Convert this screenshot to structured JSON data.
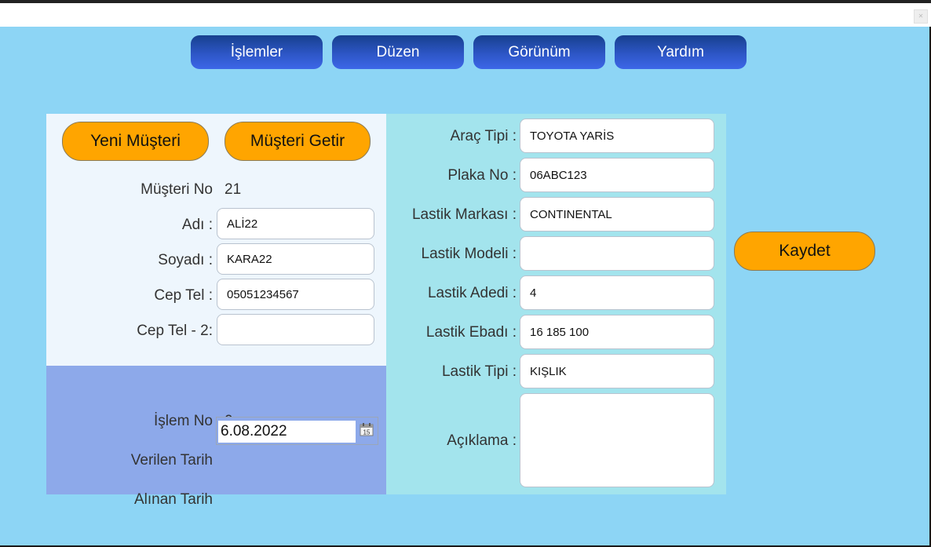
{
  "menu": {
    "items": [
      "İşlemler",
      "Düzen",
      "Görünüm",
      "Yardım"
    ]
  },
  "customer": {
    "new_button": "Yeni Müşteri",
    "fetch_button": "Müşteri Getir",
    "no_label": "Müşteri No",
    "no_value": "21",
    "name_label": "Adı :",
    "name_value": "ALİ22",
    "surname_label": "Soyadı :",
    "surname_value": "KARA22",
    "phone_label": "Cep Tel :",
    "phone_value": "05051234567",
    "phone2_label": "Cep Tel - 2:",
    "phone2_value": ""
  },
  "transaction": {
    "no_label": "İşlem No",
    "no_value": "0",
    "given_date_label": "Verilen Tarih",
    "given_date_value": "6.08.2022",
    "calendar_day": "15",
    "received_date_label": "Alınan Tarih"
  },
  "vehicle": {
    "type_label": "Araç Tipi :",
    "type_value": "TOYOTA YARİS",
    "plate_label": "Plaka No :",
    "plate_value": "06ABC123",
    "tire_brand_label": "Lastik Markası :",
    "tire_brand_value": "CONTINENTAL",
    "tire_model_label": "Lastik Modeli :",
    "tire_model_value": "",
    "tire_count_label": "Lastik Adedi :",
    "tire_count_value": "4",
    "tire_size_label": "Lastik Ebadı :",
    "tire_size_value": "16 185 100",
    "tire_type_label": "Lastik Tipi :",
    "tire_type_value": "KIŞLIK",
    "note_label": "Açıklama :",
    "note_value": ""
  },
  "actions": {
    "save_button": "Kaydet"
  },
  "icons": {
    "close": "close-icon",
    "calendar": "calendar-icon"
  },
  "colors": {
    "background": "#8dd5f5",
    "menu_button": "#2d56c6",
    "accent_button": "#ffa500",
    "customer_panel": "#eef6fd",
    "transaction_panel": "#8da9ea",
    "vehicle_panel": "#a3e4ed"
  }
}
